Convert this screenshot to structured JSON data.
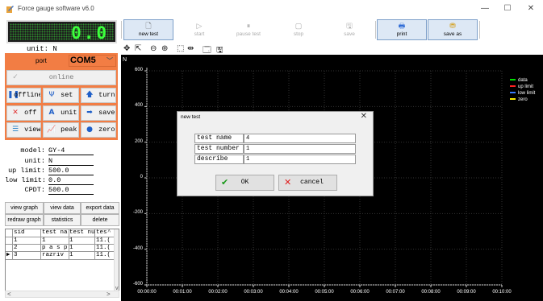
{
  "window": {
    "title": "Force gauge software v6.0",
    "min_glyph": "—",
    "max_glyph": "☐",
    "close_glyph": "✕"
  },
  "display": {
    "reading": "0.0",
    "unit_line": "unit: N"
  },
  "port": {
    "label": "port",
    "value": "COM5"
  },
  "left_buttons": {
    "online": "online",
    "offline": "offline",
    "set": "set",
    "turn": "turn",
    "off": "off",
    "unit": "unit",
    "save": "save",
    "view": "view",
    "peak": "peak",
    "zero": "zero"
  },
  "info": {
    "model_label": "model:",
    "model": "GY-4",
    "unit_label": "unit:",
    "unit": "N",
    "up_limit_label": "up limit:",
    "up_limit": "500.0",
    "low_limit_label": "low limit:",
    "low_limit": "0.0",
    "cpdt_label": "CPDT:",
    "cpdt": "500.0"
  },
  "grid_buttons": {
    "view_graph": "view graph",
    "view_data": "view data",
    "export_data": "export data",
    "redraw_graph": "redraw graph",
    "statistics": "statistics",
    "delete": "delete"
  },
  "table": {
    "headers": [
      "sid",
      "test na",
      "test num",
      "tes"
    ],
    "rows": [
      [
        "1",
        "1",
        "1",
        "11.("
      ],
      [
        "2",
        "p a s p",
        "1",
        "11.("
      ],
      [
        "3",
        "razriv",
        "1",
        "11.("
      ]
    ],
    "current_row_marker": "▶"
  },
  "toolbar": {
    "new_test": "new test",
    "start": "start",
    "pause_test": "pause test",
    "stop": "stop",
    "save": "save",
    "print": "print",
    "save_as": "save as"
  },
  "chart_data": {
    "type": "line",
    "ylabel": "N",
    "y_ticks": [
      "600",
      "400",
      "200",
      "0",
      "-200",
      "-400",
      "-600"
    ],
    "x_ticks": [
      "00:00:00",
      "00:01:00",
      "00:02:00",
      "00:03:00",
      "00:04:00",
      "00:05:00",
      "00:06:00",
      "00:07:00",
      "00:08:00",
      "00:09:00",
      "00:10:00"
    ],
    "ylim": [
      -600,
      600
    ],
    "grid": true,
    "legend_position": "top-right",
    "series": [
      {
        "name": "data",
        "color": "#00e000",
        "values": []
      },
      {
        "name": "up limit",
        "color": "#ff2020",
        "values": []
      },
      {
        "name": "low limit",
        "color": "#3a7bff",
        "values": []
      },
      {
        "name": "zero",
        "color": "#ffee00",
        "values": []
      }
    ]
  },
  "dialog": {
    "title": "new test",
    "close": "✕",
    "fields": [
      {
        "label": "test name",
        "value": "4"
      },
      {
        "label": "test number",
        "value": "1"
      },
      {
        "label": "describe",
        "value": "1"
      }
    ],
    "ok": "OK",
    "cancel": "cancel"
  }
}
